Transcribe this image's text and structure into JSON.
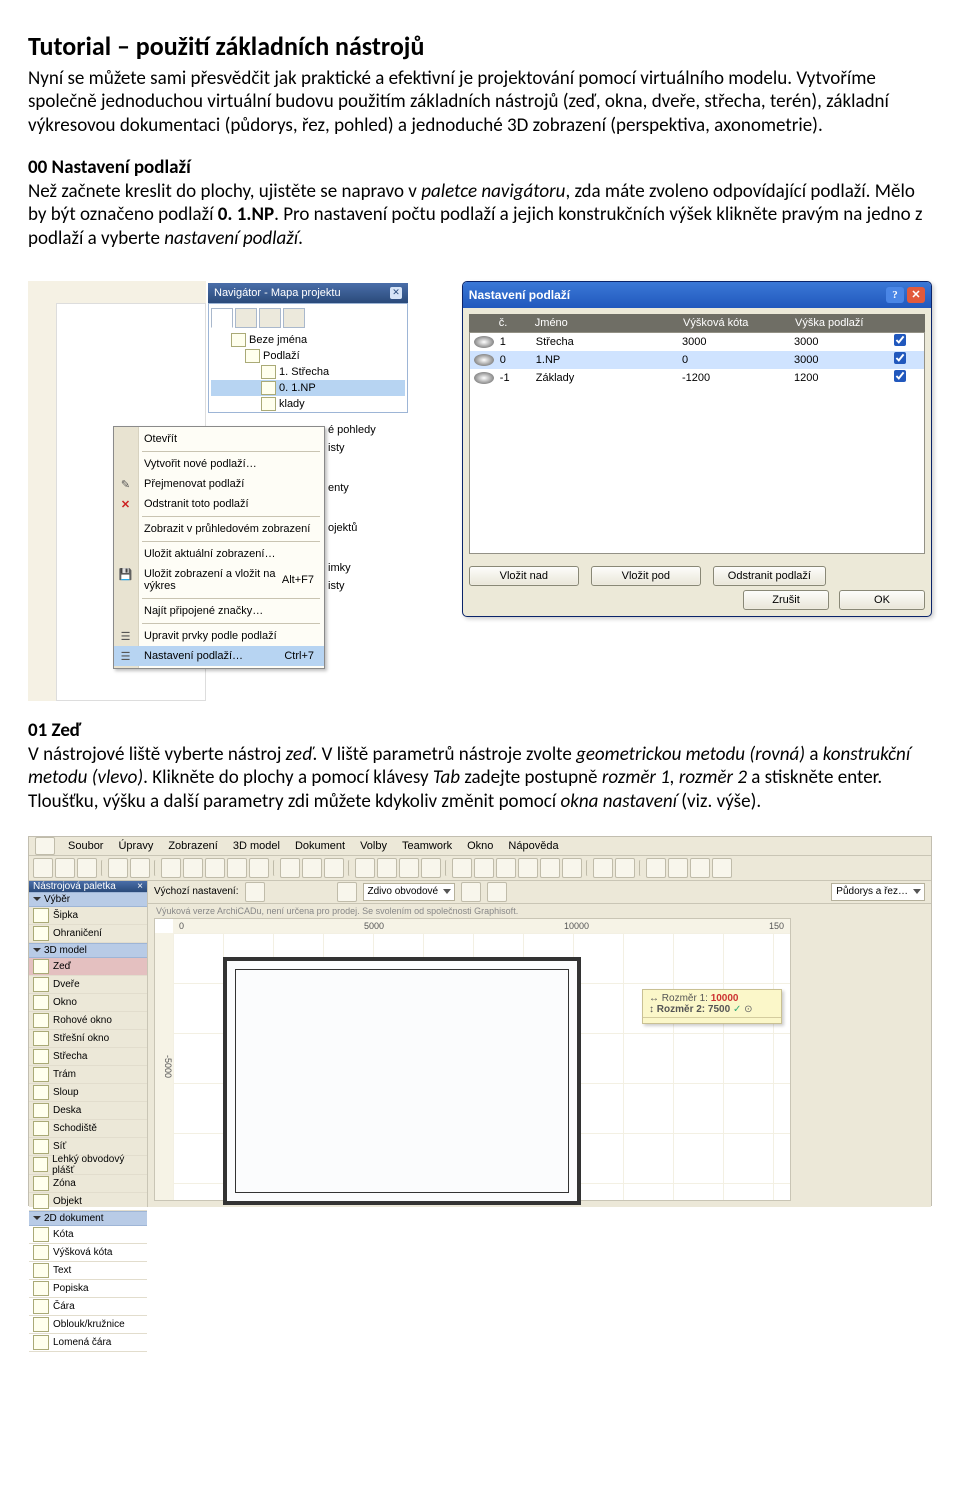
{
  "doc": {
    "title": "Tutorial – použití základních nástrojů",
    "intro1": "Nyní se můžete sami přesvědčit jak praktické a efektivní je projektování pomocí virtuálního modelu. Vytvoříme společně jednoduchou virtuální budovu použitím základních nástrojů (zeď, okna, dveře, střecha, terén), základní výkresovou dokumentaci (půdorys, řez, pohled) a jednoduché 3D zobrazení (perspektiva, axonometrie).",
    "h00": "00 Nastavení podlaží",
    "p00": "Než začnete kreslit do plochy, ujistěte se napravo v ",
    "p00_em1": "paletce navigátoru",
    "p00b": ", zda máte zvoleno odpovídající podlaží. Mělo by být označeno podlaží ",
    "p00_b1": "0. 1.NP",
    "p00c": ". Pro nastavení počtu podlaží a jejich konstrukčních výšek klikněte pravým na jedno z podlaží a vyberte ",
    "p00_em2": "nastavení podlaží",
    "p00d": ".",
    "h01": "01 Zeď",
    "p01a": "V nástrojové liště vyberte nástroj ",
    "p01a_em": "zeď",
    "p01b": ". V liště parametrů nástroje zvolte ",
    "p01b_em1": "geometrickou metodu (rovná)",
    "p01c": " a ",
    "p01b_em2": "konstrukční metodu (vlevo)",
    "p01d": ". Klikněte do plochy a pomocí klávesy ",
    "p01d_em": "Tab",
    "p01e": " zadejte postupně ",
    "p01e_em1": "rozměr 1, rozměr 2 ",
    "p01f": " a stiskněte enter. Tloušťku, výšku a další parametry zdi můžete kdykoliv změnit pomocí ",
    "p01f_em": "okna nastavení",
    "p01g": " (viz. výše)."
  },
  "nav": {
    "title": "Navigátor - Mapa projektu",
    "tree_root": "Beze jména",
    "tree_podlazi": "Podlaží",
    "tree_s": "1. Střecha",
    "tree_np": "0. 1.NP",
    "tree_z": "klady",
    "tails": [
      "é pohledy",
      "isty",
      "enty",
      "ojektů",
      "imky",
      "isty"
    ]
  },
  "ctx": {
    "items": [
      "Otevřít",
      "Vytvořit nové podlaží…",
      "Přejmenovat podlaží",
      "Odstranit toto podlaží",
      "Zobrazit v průhledovém zobrazení",
      "Uložit aktuální zobrazení…",
      "Uložit zobrazení a vložit na výkres",
      "Najít připojené značky…",
      "Upravit prvky podle podlaží",
      "Nastavení podlaží…"
    ],
    "shortcut_altF7": "Alt+F7",
    "shortcut_ctrl7": "Ctrl+7"
  },
  "dlg": {
    "title": "Nastavení podlaží",
    "cols": [
      "",
      "č.",
      "Jméno",
      "Výšková kóta",
      "Výška podlaží",
      ""
    ],
    "rows": [
      {
        "n": "1",
        "name": "Střecha",
        "kota": "3000",
        "vyska": "3000",
        "lnk": true
      },
      {
        "n": "0",
        "name": "1.NP",
        "kota": "0",
        "vyska": "3000",
        "lnk": true
      },
      {
        "n": "-1",
        "name": "Základy",
        "kota": "-1200",
        "vyska": "1200",
        "lnk": true
      }
    ],
    "btn_nad": "Vložit nad",
    "btn_pod": "Vložit pod",
    "btn_del": "Odstranit podlaží",
    "btn_cancel": "Zrušit",
    "btn_ok": "OK"
  },
  "app": {
    "menu": [
      "Soubor",
      "Úpravy",
      "Zobrazení",
      "3D model",
      "Dokument",
      "Volby",
      "Teamwork",
      "Okno",
      "Nápověda"
    ],
    "tbx_title": "Nástrojová paletka",
    "sec_vyber": "Výběr",
    "sec_3d": "3D model",
    "sec_2d": "2D dokument",
    "tools_vyber": [
      "Šipka",
      "Ohraničení"
    ],
    "tools_3d": [
      "Zeď",
      "Dveře",
      "Okno",
      "Rohové okno",
      "Střešní okno",
      "Střecha",
      "Trám",
      "Sloup",
      "Deska",
      "Schodiště",
      "Síť",
      "Lehký obvodový plášť",
      "Zóna",
      "Objekt"
    ],
    "tools_2d": [
      "Kóta",
      "Výšková kóta",
      "Text",
      "Popiska",
      "Čára",
      "Oblouk/kružnice",
      "Lomená čára"
    ],
    "params_vychozi": "Výchozí nastavení:",
    "params_zdivo": "Zdivo obvodové",
    "params_pudorys": "Půdorys a řez…",
    "watermark": "Výuková verze ArchiCADu, není určena pro prodej. Se svolením od společnosti Graphisoft.",
    "ruler_marks": [
      "0",
      "5000",
      "10000",
      "150"
    ],
    "ruler_left": "-5000",
    "tracker_r1_label": "Rozměr 1:",
    "tracker_r1_val": "10000",
    "tracker_r2_label": "Rozměr 2:",
    "tracker_r2_val": "7500"
  }
}
